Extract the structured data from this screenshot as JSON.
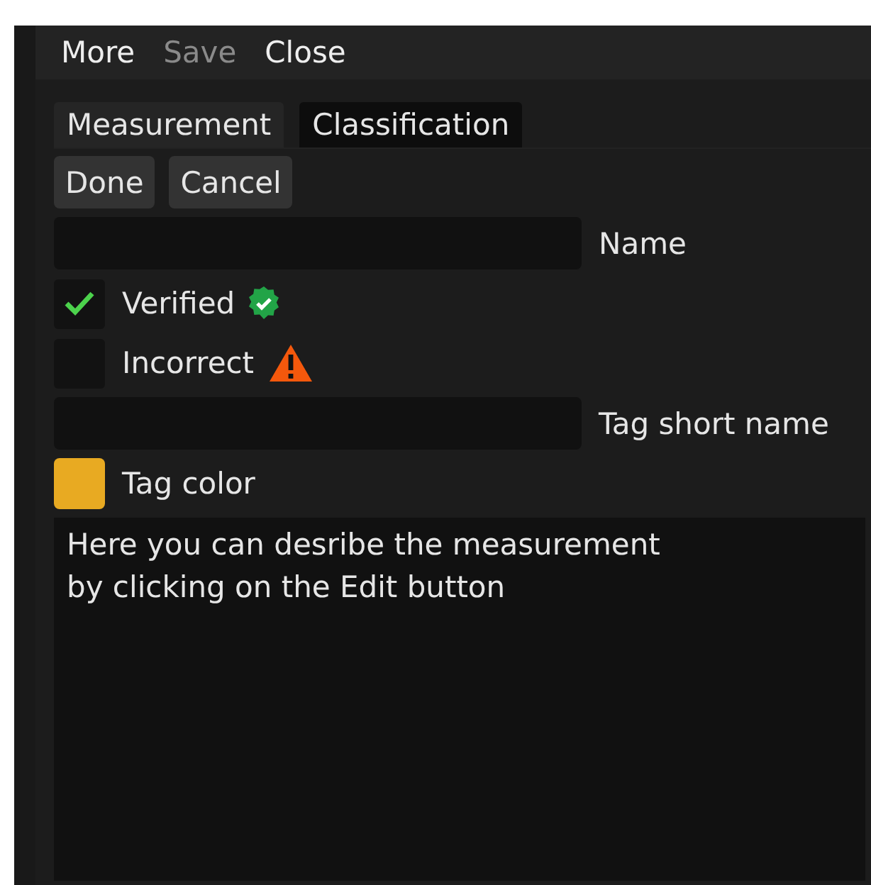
{
  "menu": [
    {
      "label": "More",
      "disabled": false
    },
    {
      "label": "Save",
      "disabled": true
    },
    {
      "label": "Close",
      "disabled": false
    }
  ],
  "tabs": [
    {
      "label": "Measurement",
      "selected": false
    },
    {
      "label": "Classification",
      "selected": true
    }
  ],
  "buttons": [
    "Done",
    "Cancel"
  ],
  "rows": [
    {
      "kind": "text-field",
      "label": "Name"
    },
    {
      "kind": "checkbox",
      "label": "Verified",
      "checked": true
    },
    {
      "kind": "checkbox",
      "label": "Incorrect",
      "checked": false
    },
    {
      "kind": "text-field",
      "label": "Tag short name"
    },
    {
      "kind": "color",
      "label": "Tag color",
      "color": "#e8aa22"
    }
  ],
  "description": "Here you can desribe the measurement\nby clicking on the Edit button"
}
